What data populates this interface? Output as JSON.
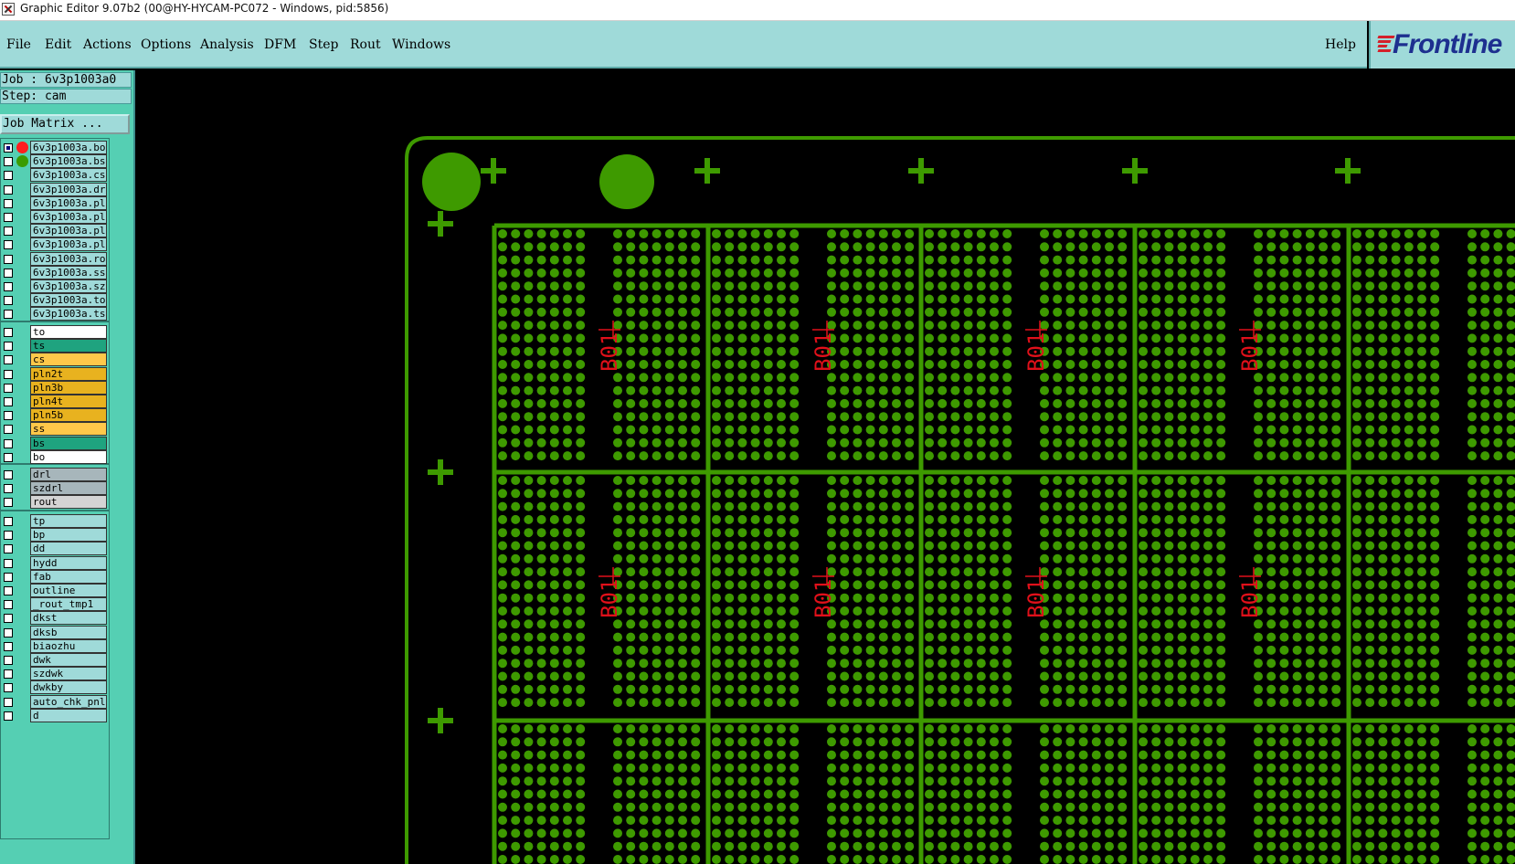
{
  "window": {
    "title": "Graphic Editor 9.07b2 (00@HY-HYCAM-PC072 - Windows, pid:5856)"
  },
  "menu": {
    "items": [
      {
        "label": "File"
      },
      {
        "label": "Edit"
      },
      {
        "label": "Actions"
      },
      {
        "label": "Options"
      },
      {
        "label": "Analysis"
      },
      {
        "label": "DFM"
      },
      {
        "label": "Step"
      },
      {
        "label": "Rout"
      },
      {
        "label": "Windows"
      }
    ],
    "help_label": "Help"
  },
  "logo": {
    "text": "Frontline"
  },
  "job_info": {
    "job_line": "Job : 6v3p1003a0",
    "step_line": "Step: cam",
    "job_matrix_label": "Job Matrix ..."
  },
  "layers": {
    "file_layers": [
      {
        "name": "6v3p1003a.bo",
        "checked": true,
        "dot": "#ff1f1f",
        "color": "#9fdad9"
      },
      {
        "name": "6v3p1003a.bs",
        "checked": false,
        "dot": "#3a9c00",
        "color": "#9fdad9"
      },
      {
        "name": "6v3p1003a.cs",
        "checked": false,
        "dot": "",
        "color": "#9fdad9"
      },
      {
        "name": "6v3p1003a.dr",
        "checked": false,
        "dot": "",
        "color": "#9fdad9"
      },
      {
        "name": "6v3p1003a.pl",
        "checked": false,
        "dot": "",
        "color": "#9fdad9"
      },
      {
        "name": "6v3p1003a.pl",
        "checked": false,
        "dot": "",
        "color": "#9fdad9"
      },
      {
        "name": "6v3p1003a.pl",
        "checked": false,
        "dot": "",
        "color": "#9fdad9"
      },
      {
        "name": "6v3p1003a.pl",
        "checked": false,
        "dot": "",
        "color": "#9fdad9"
      },
      {
        "name": "6v3p1003a.ro",
        "checked": false,
        "dot": "",
        "color": "#9fdad9"
      },
      {
        "name": "6v3p1003a.ss",
        "checked": false,
        "dot": "",
        "color": "#9fdad9"
      },
      {
        "name": "6v3p1003a.sz",
        "checked": false,
        "dot": "",
        "color": "#9fdad9"
      },
      {
        "name": "6v3p1003a.to",
        "checked": false,
        "dot": "",
        "color": "#9fdad9"
      },
      {
        "name": "6v3p1003a.ts",
        "checked": false,
        "dot": "",
        "color": "#9fdad9"
      }
    ],
    "board_layers": [
      {
        "name": "to",
        "color": "#ffffff"
      },
      {
        "name": "ts",
        "color": "#1fa37f"
      },
      {
        "name": "cs",
        "color": "#ffc84a"
      },
      {
        "name": "pln2t",
        "color": "#e8b21f"
      },
      {
        "name": "pln3b",
        "color": "#e8b21f"
      },
      {
        "name": "pln4t",
        "color": "#e8b21f"
      },
      {
        "name": "pln5b",
        "color": "#e8b21f"
      },
      {
        "name": "ss",
        "color": "#ffc84a"
      },
      {
        "name": "bs",
        "color": "#1fa37f"
      },
      {
        "name": "bo",
        "color": "#ffffff"
      }
    ],
    "drill_layers": [
      {
        "name": "drl",
        "color": "#a7b6bb"
      },
      {
        "name": "szdrl",
        "color": "#a7b6bb"
      },
      {
        "name": "rout",
        "color": "#d4d4d4"
      }
    ],
    "misc_layers": [
      {
        "name": "tp",
        "color": "#9fdad9"
      },
      {
        "name": "bp",
        "color": "#9fdad9"
      },
      {
        "name": "dd",
        "color": "#9fdad9"
      },
      {
        "name": "hydd",
        "color": "#9fdad9"
      },
      {
        "name": "fab",
        "color": "#9fdad9"
      },
      {
        "name": "outline",
        "color": "#9fdad9"
      },
      {
        "name": "_rout_tmp1",
        "color": "#9fdad9"
      },
      {
        "name": "dkst",
        "color": "#9fdad9"
      },
      {
        "name": "dksb",
        "color": "#9fdad9"
      },
      {
        "name": "biaozhu",
        "color": "#9fdad9"
      },
      {
        "name": "dwk",
        "color": "#9fdad9"
      },
      {
        "name": "szdwk",
        "color": "#9fdad9"
      },
      {
        "name": "dwkby",
        "color": "#9fdad9"
      },
      {
        "name": "auto_chk_pnl",
        "color": "#9fdad9"
      },
      {
        "name": "d",
        "color": "#9fdad9"
      }
    ]
  },
  "canvas": {
    "pcb_color": "#3e9a00",
    "label_color": "#e0101a",
    "step_label": "B01"
  }
}
